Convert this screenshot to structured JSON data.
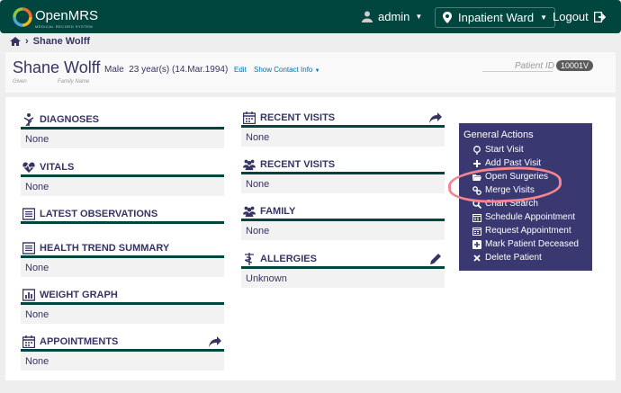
{
  "app": {
    "logo_text": "OpenMRS",
    "logo_sub": "MEDICAL RECORD SYSTEM"
  },
  "nav": {
    "user": "admin",
    "location": "Inpatient Ward",
    "logout": "Logout"
  },
  "breadcrumb": {
    "patient": "Shane Wolff"
  },
  "patient": {
    "name": "Shane Wolff",
    "given_label": "Given",
    "family_label": "Family Name",
    "gender_age": "Male  23 year(s) (14.Mar.1994)",
    "edit": "Edit",
    "contact": "Show Contact Info",
    "id_label": "Patient ID",
    "id": "10001V"
  },
  "widgets": {
    "diagnoses": {
      "title": "DIAGNOSES",
      "value": "None"
    },
    "vitals": {
      "title": "VITALS",
      "value": "None"
    },
    "latest_obs": {
      "title": "LATEST OBSERVATIONS"
    },
    "health_trend": {
      "title": "HEALTH TREND SUMMARY",
      "value": "None"
    },
    "weight_graph": {
      "title": "WEIGHT GRAPH",
      "value": "None"
    },
    "appointments": {
      "title": "APPOINTMENTS",
      "value": "None"
    },
    "recent_visits_1": {
      "title": "RECENT VISITS",
      "value": "None"
    },
    "recent_visits_2": {
      "title": "RECENT VISITS",
      "value": "None"
    },
    "family": {
      "title": "FAMILY",
      "value": "None"
    },
    "allergies": {
      "title": "ALLERGIES",
      "value": "Unknown"
    }
  },
  "general_actions": {
    "title": "General Actions",
    "items": [
      {
        "label": "Start Visit",
        "icon": "location-pin-icon"
      },
      {
        "label": "Add Past Visit",
        "icon": "plus-icon"
      },
      {
        "label": "Open Surgeries",
        "icon": "folder-open-icon"
      },
      {
        "label": "Merge Visits",
        "icon": "link-icon"
      },
      {
        "label": "Chart Search",
        "icon": "search-icon"
      },
      {
        "label": "Schedule Appointment",
        "icon": "calendar-icon"
      },
      {
        "label": "Request Appointment",
        "icon": "calendar-icon"
      },
      {
        "label": "Mark Patient Deceased",
        "icon": "plus-square-icon"
      },
      {
        "label": "Delete Patient",
        "icon": "x-icon"
      }
    ]
  },
  "colors": {
    "topbar": "#00463f",
    "actions_panel": "#3a3870",
    "text": "#363463",
    "highlight": "#f48590"
  }
}
